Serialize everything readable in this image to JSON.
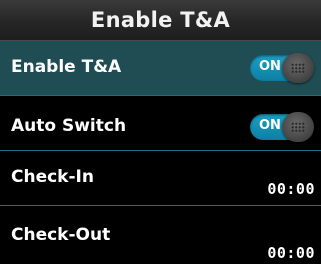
{
  "header": {
    "title": "Enable T&A"
  },
  "rows": [
    {
      "label": "Enable T&A",
      "type": "toggle",
      "toggle_text": "ON",
      "selected": true
    },
    {
      "label": "Auto Switch",
      "type": "toggle",
      "toggle_text": "ON",
      "selected": false
    },
    {
      "label": "Check-In",
      "type": "time",
      "value": "00:00",
      "selected": false
    },
    {
      "label": "Check-Out",
      "type": "time",
      "value": "00:00",
      "selected": false
    }
  ],
  "colors": {
    "selected_row": "#1f4d53",
    "divider": "#1d6f7e",
    "toggle_on": "#1a9fc6",
    "background": "#000000"
  }
}
